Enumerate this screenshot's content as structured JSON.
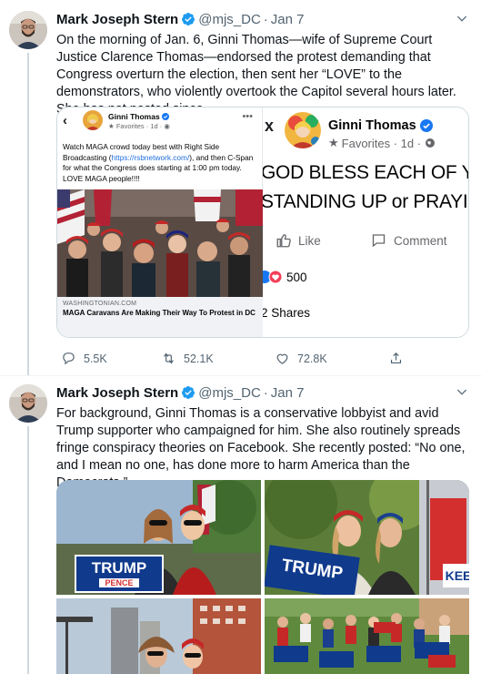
{
  "tweets": [
    {
      "author": {
        "name": "Mark Joseph Stern",
        "handle": "@mjs_DC",
        "date": "Jan 7"
      },
      "text": "On the morning of Jan. 6, Ginni Thomas—wife of Supreme Court Justice Clarence Thomas—endorsed the protest demanding that Congress overturn the election, then sent her “LOVE” to the demonstrators, who violently overtook the Capitol several hours later. She has not posted since.",
      "media": {
        "phone_post": {
          "name": "Ginni Thomas",
          "meta": "Favorites · 1d ·",
          "text_before_link": "Watch MAGA crowd today best with Right Side Broadcasting (",
          "link": "https://rsbnetwork.com/",
          "text_after_link": "), and then C-Span for what the Congress does starting at 1:00 pm today. LOVE MAGA people!!!!",
          "card_domain": "WASHINGTONIAN.COM",
          "card_headline": "MAGA Caravans Are Making Their Way To Protest in DC"
        },
        "fb_post": {
          "close": "x",
          "name": "Ginni Thomas",
          "meta": "Favorites · 1d ·",
          "line1": "GOD BLESS EACH OF Y",
          "line2": "STANDING UP or PRAYI",
          "like_label": "Like",
          "comment_label": "Comment",
          "reactions": "500",
          "shares": "2 Shares"
        }
      },
      "stats": {
        "replies": "5.5K",
        "retweets": "52.1K",
        "likes": "72.8K"
      }
    },
    {
      "author": {
        "name": "Mark Joseph Stern",
        "handle": "@mjs_DC",
        "date": "Jan 7"
      },
      "text": "For background, Ginni Thomas is a conservative lobbyist and avid Trump supporter who campaigned for him. She also routinely spreads fringe conspiracy theories on Facebook. She recently posted: “No one, and I mean no one, has done more to harm America than the Democrats.”",
      "sign_text": {
        "top": "TRUMP",
        "bottom": "PENCE",
        "partial_a": "TRUMP",
        "partial_b": "KEE"
      }
    }
  ],
  "colors": {
    "accent": "#1d9bf0",
    "muted": "#536471",
    "fb_blue": "#1877f2"
  }
}
